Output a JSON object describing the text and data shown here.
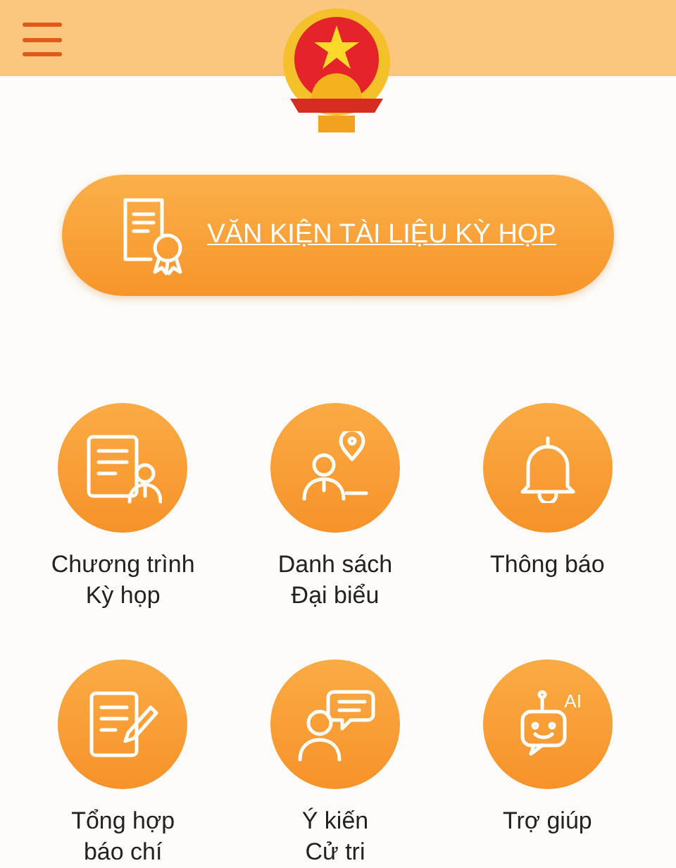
{
  "main_button": {
    "label": "VĂN KIỆN TÀI LIỆU KỲ HỌP"
  },
  "tiles": [
    {
      "kind": "agenda",
      "lines": [
        "Chương trình",
        "Kỳ họp"
      ]
    },
    {
      "kind": "delegates",
      "lines": [
        "Danh sách",
        "Đại biểu"
      ]
    },
    {
      "kind": "bell",
      "lines": [
        "Thông báo"
      ]
    },
    {
      "kind": "press",
      "lines": [
        "Tổng hợp",
        "báo chí"
      ]
    },
    {
      "kind": "feedback",
      "lines": [
        "Ý kiến",
        "Cử tri"
      ]
    },
    {
      "kind": "help",
      "lines": [
        "Trợ giúp"
      ],
      "badge": "AI"
    }
  ]
}
